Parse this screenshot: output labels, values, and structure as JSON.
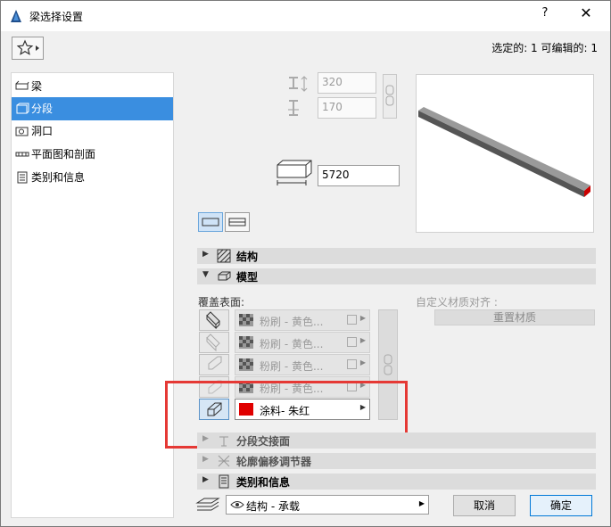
{
  "window": {
    "title": "梁选择设置",
    "help": "?",
    "close": "✕"
  },
  "header": {
    "selected_info": "选定的: 1 可编辑的: 1"
  },
  "sidebar": {
    "items": [
      {
        "label": "梁"
      },
      {
        "label": "分段"
      },
      {
        "label": "洞口"
      },
      {
        "label": "平面图和剖面"
      },
      {
        "label": "类别和信息"
      }
    ]
  },
  "geometry_panel": {
    "width_value": "320",
    "height_value": "170",
    "length_value": "5720"
  },
  "sections": {
    "structure": "结构",
    "model": "模型",
    "segment_joint": "分段交接面",
    "profile_offset": "轮廓偏移调节器",
    "category_info": "类别和信息"
  },
  "model_panel": {
    "cover_surfaces_label": "覆盖表面:",
    "custom_alignment_label": "自定义材质对齐 :",
    "reset_material_button": "重置材质",
    "surfaces": [
      {
        "label": "粉刷 - 黄色...",
        "color": "#888888"
      },
      {
        "label": "粉刷 - 黄色...",
        "color": "#888888"
      },
      {
        "label": "粉刷 - 黄色...",
        "color": "#888888"
      },
      {
        "label": "粉刷 - 黄色...",
        "color": "#888888"
      },
      {
        "label": "涂料- 朱红",
        "color": "#e00000"
      }
    ]
  },
  "footer": {
    "layer_select": "结构 - 承载",
    "cancel_button": "取消",
    "ok_button": "确定"
  }
}
